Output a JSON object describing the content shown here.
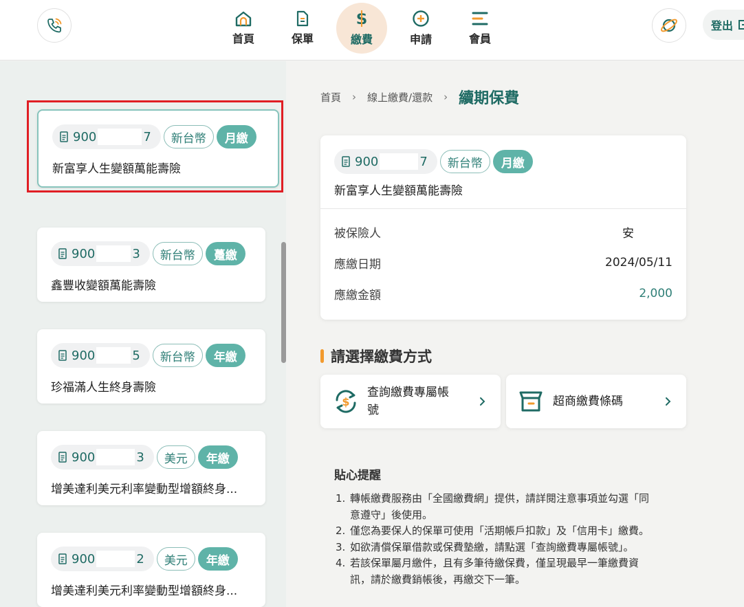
{
  "nav": {
    "items": [
      {
        "label": "首頁",
        "icon": "home-icon"
      },
      {
        "label": "保單",
        "icon": "document-icon"
      },
      {
        "label": "繳費",
        "icon": "dollar-icon"
      },
      {
        "label": "申請",
        "icon": "plus-circle-icon"
      },
      {
        "label": "會員",
        "icon": "menu-icon"
      }
    ],
    "active": "繳費",
    "logout_label": "登出"
  },
  "policies": [
    {
      "number_start": "900",
      "number_end": "7",
      "currency": "新台幣",
      "frequency": "月繳",
      "name": "新富享人生變額萬能壽險",
      "selected": true
    },
    {
      "number_start": "900",
      "number_end": "3",
      "currency": "新台幣",
      "frequency": "躉繳",
      "name": "鑫豐收變額萬能壽險",
      "selected": false
    },
    {
      "number_start": "900",
      "number_end": "5",
      "currency": "新台幣",
      "frequency": "年繳",
      "name": "珍福滿人生終身壽險",
      "selected": false
    },
    {
      "number_start": "900",
      "number_end": "3",
      "currency": "美元",
      "frequency": "年繳",
      "name": "增美達利美元利率變動型增額終身...",
      "selected": false
    },
    {
      "number_start": "900",
      "number_end": "2",
      "currency": "美元",
      "frequency": "年繳",
      "name": "增美達利美元利率變動型增額終身...",
      "selected": false
    }
  ],
  "breadcrumb": {
    "home": "首頁",
    "parent": "線上繳費/還款",
    "current": "續期保費"
  },
  "detail": {
    "number_start": "900",
    "number_end": "7",
    "currency": "新台幣",
    "frequency": "月繳",
    "name": "新富享人生變額萬能壽險",
    "rows": [
      {
        "label": "被保險人",
        "value": "安"
      },
      {
        "label": "應繳日期",
        "value": "2024/05/11"
      },
      {
        "label": "應繳金額",
        "value": "2,000"
      }
    ]
  },
  "payment_section": {
    "title": "請選擇繳費方式",
    "methods": [
      {
        "label_line1": "查詢繳費專屬帳",
        "label_line2": "號",
        "icon": "refresh-dollar-icon"
      },
      {
        "label_line1": "超商繳費條碼",
        "label_line2": "",
        "icon": "store-icon"
      }
    ]
  },
  "tips": {
    "title": "貼心提醒",
    "items": [
      {
        "num": "1.",
        "lines": [
          "轉帳繳費服務由「全國繳費網」提供，請詳閱注意事項並勾選「同",
          "意遵守」後使用。"
        ]
      },
      {
        "num": "2.",
        "lines": [
          "僅您為要保人的保單可使用「活期帳戶扣款」及「信用卡」繳費。"
        ]
      },
      {
        "num": "3.",
        "lines": [
          "如欲清償保單借款或保費墊繳，請點選「查詢繳費專屬帳號」。"
        ]
      },
      {
        "num": "4.",
        "lines": [
          "若該保單屬月繳件，且有多筆待繳保費，僅呈現最早一筆繳費資",
          "訊，請於繳費銷帳後，再繳交下一筆。"
        ]
      }
    ]
  },
  "colors": {
    "brand": "#1f6b64",
    "accent": "#5fb3a8",
    "active_bg": "#f8e6d6",
    "highlight": "#e01e24",
    "section_bar": "#f29a2e"
  }
}
